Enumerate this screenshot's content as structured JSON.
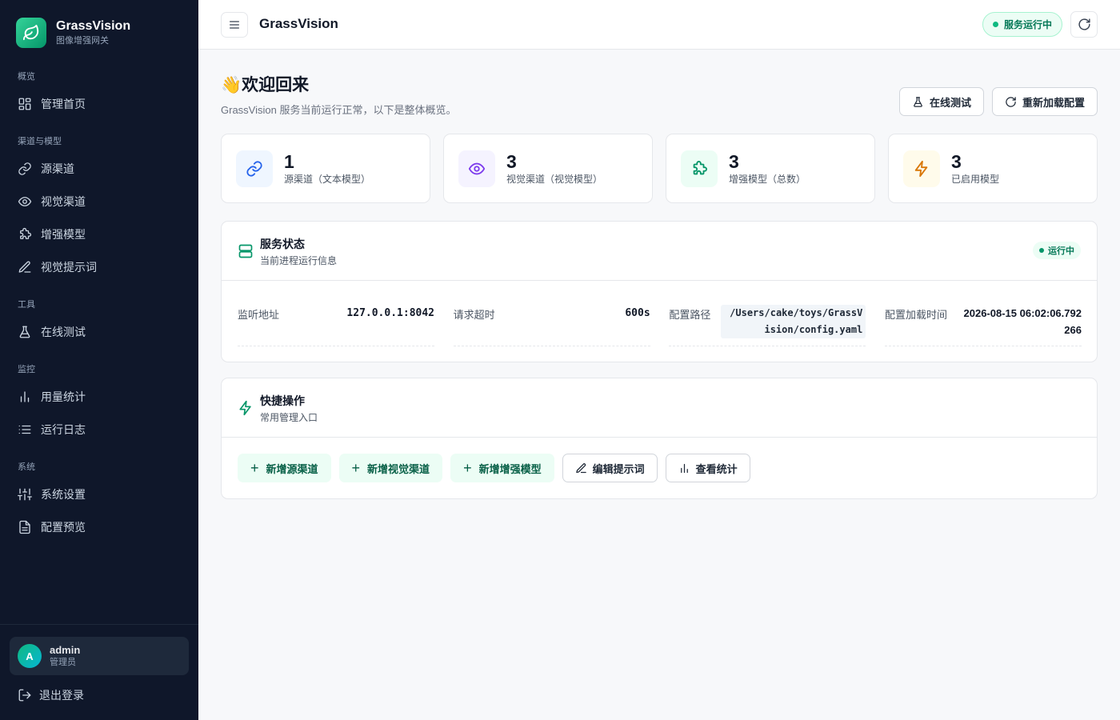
{
  "brand": {
    "name": "GrassVision",
    "subtitle": "图像增强网关"
  },
  "nav": {
    "sections": [
      {
        "title": "概览",
        "items": [
          {
            "label": "管理首页",
            "icon": "dashboard-icon"
          }
        ]
      },
      {
        "title": "渠道与模型",
        "items": [
          {
            "label": "源渠道",
            "icon": "link-icon"
          },
          {
            "label": "视觉渠道",
            "icon": "eye-icon"
          },
          {
            "label": "增强模型",
            "icon": "puzzle-icon"
          },
          {
            "label": "视觉提示词",
            "icon": "pencil-icon"
          }
        ]
      },
      {
        "title": "工具",
        "items": [
          {
            "label": "在线测试",
            "icon": "flask-icon"
          }
        ]
      },
      {
        "title": "监控",
        "items": [
          {
            "label": "用量统计",
            "icon": "bar-chart-icon"
          },
          {
            "label": "运行日志",
            "icon": "list-icon"
          }
        ]
      },
      {
        "title": "系统",
        "items": [
          {
            "label": "系统设置",
            "icon": "sliders-icon"
          },
          {
            "label": "配置预览",
            "icon": "file-icon"
          }
        ]
      }
    ]
  },
  "user": {
    "initial": "A",
    "name": "admin",
    "role": "管理员",
    "logout": "退出登录"
  },
  "topbar": {
    "title": "GrassVision",
    "status": "服务运行中"
  },
  "header": {
    "welcome": "👋欢迎回来",
    "subtitle": "GrassVision 服务当前运行正常，以下是整体概览。",
    "test_button": "在线测试",
    "reload_button": "重新加载配置"
  },
  "stats": [
    {
      "value": "1",
      "label": "源渠道（文本模型）",
      "icon": "link-icon",
      "color": "#2563eb",
      "bg": "#eff6ff"
    },
    {
      "value": "3",
      "label": "视觉渠道（视觉模型）",
      "icon": "eye-icon",
      "color": "#7c3aed",
      "bg": "#f5f3ff"
    },
    {
      "value": "3",
      "label": "增强模型（总数）",
      "icon": "puzzle-icon",
      "color": "#059669",
      "bg": "#ecfdf5"
    },
    {
      "value": "3",
      "label": "已启用模型",
      "icon": "bolt-icon",
      "color": "#d97706",
      "bg": "#fffbeb"
    }
  ],
  "service": {
    "title": "服务状态",
    "subtitle": "当前进程运行信息",
    "badge": "运行中",
    "fields": [
      {
        "label": "监听地址",
        "value": "127.0.0.1:8042"
      },
      {
        "label": "请求超时",
        "value": "600s"
      },
      {
        "label": "配置路径",
        "value": "/Users/cake/toys/GrassVision/config.yaml"
      },
      {
        "label": "配置加载时间",
        "value": "2026-08-15 06:02:06.792266"
      }
    ]
  },
  "quick": {
    "title": "快捷操作",
    "subtitle": "常用管理入口",
    "add_source": "新增源渠道",
    "add_vision": "新增视觉渠道",
    "add_model": "新增增强模型",
    "edit_prompt": "编辑提示词",
    "view_stats": "查看统计"
  }
}
